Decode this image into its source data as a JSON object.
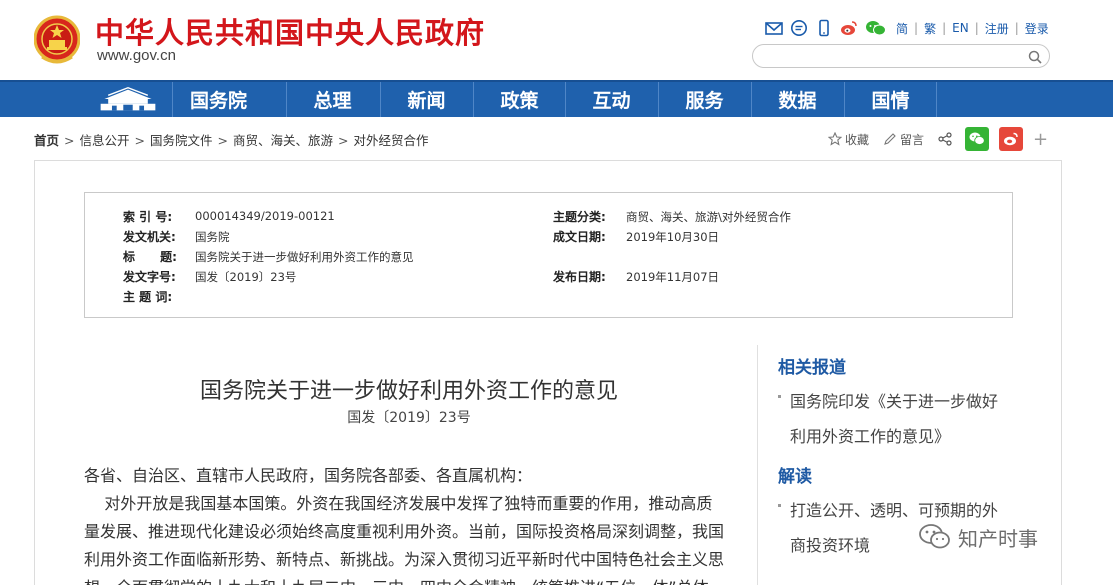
{
  "header": {
    "site_title": "中华人民共和国中央人民政府",
    "site_url": "www.gov.cn",
    "lang_links": [
      "简",
      "繁",
      "EN",
      "注册",
      "登录"
    ],
    "search_placeholder": ""
  },
  "nav": {
    "items": [
      "国务院",
      "总理",
      "新闻",
      "政策",
      "互动",
      "服务",
      "数据",
      "国情"
    ]
  },
  "breadcrumb": {
    "home": "首页",
    "items": [
      "信息公开",
      "国务院文件",
      "商贸、海关、旅游",
      "对外经贸合作"
    ],
    "separator": ">"
  },
  "tools": {
    "favorite": "收藏",
    "comment": "留言",
    "plus": "+"
  },
  "info": {
    "index_label": "索 引 号:",
    "index_value": "000014349/2019-00121",
    "topic_label": "主题分类:",
    "topic_value": "商贸、海关、旅游\\对外经贸合作",
    "issuer_label": "发文机关:",
    "issuer_value": "国务院",
    "date_label": "成文日期:",
    "date_value": "2019年10月30日",
    "title_label": "标      题:",
    "title_value": "国务院关于进一步做好利用外资工作的意见",
    "docno_label": "发文字号:",
    "docno_value": "国发〔2019〕23号",
    "publish_label": "发布日期:",
    "publish_value": "2019年11月07日",
    "keywords_label": "主 题 词:"
  },
  "article": {
    "title": "国务院关于进一步做好利用外资工作的意见",
    "doc_number": "国发〔2019〕23号",
    "lines": [
      "各省、自治区、直辖市人民政府，国务院各部委、各直属机构：",
      "    对外开放是我国基本国策。外资在我国经济发展中发挥了独特而重要的作用，推动高质",
      "量发展、推进现代化建设必须始终高度重视利用外资。当前，国际投资格局深刻调整，我国",
      "利用外资工作面临新形势、新特点、新挑战。为深入贯彻习近平新时代中国特色社会主义思",
      "想，全面贯彻党的十九大和十九届二中、三中、四中全会精神，统筹推进“五位一体”总体"
    ]
  },
  "sidebar": {
    "related_heading": "相关报道",
    "related_line1": "国务院印发《关于进一步做好",
    "related_line2": "利用外资工作的意见》",
    "interpret_heading": "解读",
    "interpret_line1": "打造公开、透明、可预期的外",
    "interpret_line2": "商投资环境"
  },
  "watermark": {
    "text": "知产时事"
  },
  "colors": {
    "brand_red": "#d3161b",
    "nav_blue": "#1f61ad",
    "link_blue": "#1f5aa4",
    "wechat_green": "#35b435",
    "weibo_red": "#e6473a"
  }
}
